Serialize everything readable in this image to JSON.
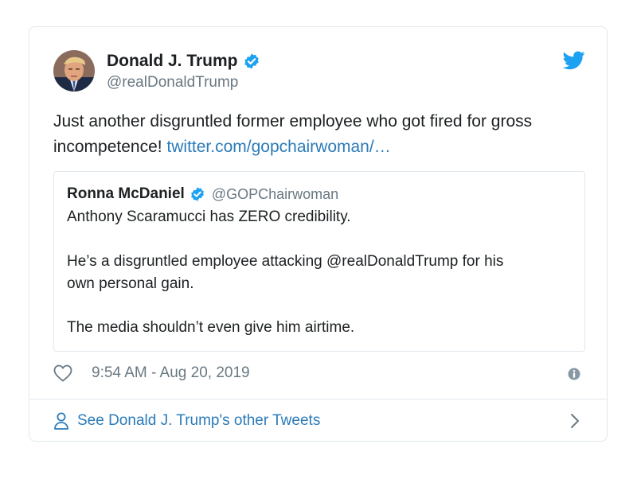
{
  "author": {
    "name": "Donald J. Trump",
    "handle": "@realDonaldTrump",
    "verified": true
  },
  "tweet": {
    "text": "Just another disgruntled former employee who got fired for gross incompetence! ",
    "link": "twitter.com/gopchairwoman/…"
  },
  "quoted": {
    "name": "Ronna McDaniel",
    "handle": "@GOPChairwoman",
    "verified": true,
    "lines": [
      "Anthony Scaramucci has ZERO credibility.",
      "He’s a disgruntled employee attacking @realDonaldTrump for his",
      "own personal gain.",
      "The media shouldn’t even give him airtime."
    ]
  },
  "meta": {
    "timestamp": "9:54 AM - Aug 20, 2019"
  },
  "footer": {
    "label": "See Donald J. Trump's other Tweets"
  },
  "icons": {
    "brand": "twitter-bird-icon",
    "verified": "verified-badge-icon",
    "like": "heart-icon",
    "info": "info-icon",
    "profile": "person-icon",
    "navigate": "chevron-right-icon"
  },
  "colors": {
    "text": "#1c2022",
    "secondary": "#697882",
    "link": "#2b7bb9",
    "brand": "#1da1f2",
    "border": "#e1e8ed"
  }
}
